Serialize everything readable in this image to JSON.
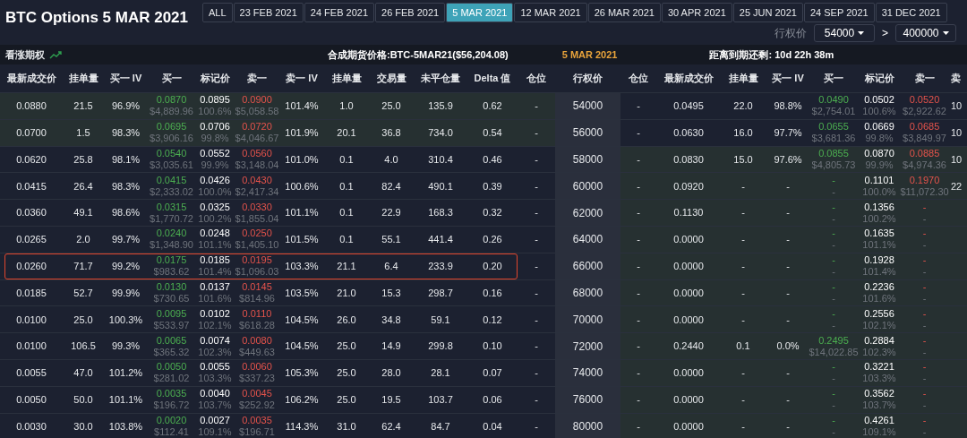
{
  "title": "BTC Options 5 MAR 2021",
  "expiry_tabs": [
    {
      "label": "ALL",
      "selected": false
    },
    {
      "label": "23 FEB 2021",
      "selected": false
    },
    {
      "label": "24 FEB 2021",
      "selected": false
    },
    {
      "label": "26 FEB 2021",
      "selected": false
    },
    {
      "label": "5 MAR 2021",
      "selected": true
    },
    {
      "label": "12 MAR 2021",
      "selected": false
    },
    {
      "label": "26 MAR 2021",
      "selected": false
    },
    {
      "label": "30 APR 2021",
      "selected": false
    },
    {
      "label": "25 JUN 2021",
      "selected": false
    },
    {
      "label": "24 SEP 2021",
      "selected": false
    },
    {
      "label": "31 DEC 2021",
      "selected": false
    }
  ],
  "strike_filter": {
    "label": "行权价",
    "min": "54000",
    "separator": ">",
    "max": "400000"
  },
  "info_bar": {
    "side_label": "看涨期权",
    "futures_price": "合成期货价格:BTC-5MAR21($56,204.08)",
    "expiry": "5 MAR 2021",
    "time_left": "距离到期还剩: 10d 22h 38m"
  },
  "call_columns": [
    {
      "label": "最新成交价"
    },
    {
      "label": "挂单量"
    },
    {
      "label": "买一 IV"
    },
    {
      "label": "买一",
      "kind": "bid"
    },
    {
      "label": "标记价",
      "kind": "mark"
    },
    {
      "label": "卖一",
      "kind": "ask"
    },
    {
      "label": "卖一 IV"
    },
    {
      "label": "挂单量"
    },
    {
      "label": "交易量"
    },
    {
      "label": "未平仓量"
    },
    {
      "label": "Delta 值"
    },
    {
      "label": "仓位"
    }
  ],
  "strike_column": "行权价",
  "put_columns": [
    {
      "label": "仓位"
    },
    {
      "label": "最新成交价"
    },
    {
      "label": "挂单量"
    },
    {
      "label": "买一 IV"
    },
    {
      "label": "买一",
      "kind": "bid"
    },
    {
      "label": "标记价",
      "kind": "mark"
    },
    {
      "label": "卖一",
      "kind": "ask"
    },
    {
      "label": "卖"
    }
  ],
  "rows": [
    {
      "strike": "54000",
      "call_itm": true,
      "put_itm": false,
      "highlighted": false,
      "call": [
        "0.0880",
        "21.5",
        "96.9%",
        {
          "price": "0.0870",
          "sub": "$4,889.96"
        },
        {
          "price": "0.0895",
          "sub": "100.6%"
        },
        {
          "price": "0.0900",
          "sub": "$5,058.58"
        },
        "101.4%",
        "1.0",
        "25.0",
        "135.9",
        "0.62",
        "-"
      ],
      "put": [
        "-",
        "0.0495",
        "22.0",
        "98.8%",
        {
          "price": "0.0490",
          "sub": "$2,754.01"
        },
        {
          "price": "0.0502",
          "sub": "100.6%"
        },
        {
          "price": "0.0520",
          "sub": "$2,922.62"
        },
        "10"
      ]
    },
    {
      "strike": "56000",
      "call_itm": true,
      "put_itm": false,
      "highlighted": false,
      "call": [
        "0.0700",
        "1.5",
        "98.3%",
        {
          "price": "0.0695",
          "sub": "$3,906.16"
        },
        {
          "price": "0.0706",
          "sub": "99.8%"
        },
        {
          "price": "0.0720",
          "sub": "$4,046.67"
        },
        "101.9%",
        "20.1",
        "36.8",
        "734.0",
        "0.54",
        "-"
      ],
      "put": [
        "-",
        "0.0630",
        "16.0",
        "97.7%",
        {
          "price": "0.0655",
          "sub": "$3,681.36"
        },
        {
          "price": "0.0669",
          "sub": "99.8%"
        },
        {
          "price": "0.0685",
          "sub": "$3,849.97"
        },
        "10"
      ]
    },
    {
      "strike": "58000",
      "call_itm": false,
      "put_itm": true,
      "highlighted": false,
      "call": [
        "0.0620",
        "25.8",
        "98.1%",
        {
          "price": "0.0540",
          "sub": "$3,035.61"
        },
        {
          "price": "0.0552",
          "sub": "99.9%"
        },
        {
          "price": "0.0560",
          "sub": "$3,148.04"
        },
        "101.0%",
        "0.1",
        "4.0",
        "310.4",
        "0.46",
        "-"
      ],
      "put": [
        "-",
        "0.0830",
        "15.0",
        "97.6%",
        {
          "price": "0.0855",
          "sub": "$4,805.73"
        },
        {
          "price": "0.0870",
          "sub": "99.9%"
        },
        {
          "price": "0.0885",
          "sub": "$4,974.36"
        },
        "10"
      ]
    },
    {
      "strike": "60000",
      "call_itm": false,
      "put_itm": true,
      "highlighted": false,
      "call": [
        "0.0415",
        "26.4",
        "98.3%",
        {
          "price": "0.0415",
          "sub": "$2,333.02"
        },
        {
          "price": "0.0426",
          "sub": "100.0%"
        },
        {
          "price": "0.0430",
          "sub": "$2,417.34"
        },
        "100.6%",
        "0.1",
        "82.4",
        "490.1",
        "0.39",
        "-"
      ],
      "put": [
        "-",
        "0.0920",
        "-",
        "-",
        {
          "price": "-",
          "sub": "-"
        },
        {
          "price": "0.1101",
          "sub": "100.0%"
        },
        {
          "price": "0.1970",
          "sub": "$11,072.30"
        },
        "22"
      ]
    },
    {
      "strike": "62000",
      "call_itm": false,
      "put_itm": true,
      "highlighted": false,
      "call": [
        "0.0360",
        "49.1",
        "98.6%",
        {
          "price": "0.0315",
          "sub": "$1,770.72"
        },
        {
          "price": "0.0325",
          "sub": "100.2%"
        },
        {
          "price": "0.0330",
          "sub": "$1,855.04"
        },
        "101.1%",
        "0.1",
        "22.9",
        "168.3",
        "0.32",
        "-"
      ],
      "put": [
        "-",
        "0.1130",
        "-",
        "-",
        {
          "price": "-",
          "sub": "-"
        },
        {
          "price": "0.1356",
          "sub": "100.2%"
        },
        {
          "price": "-",
          "sub": "-"
        }
      ]
    },
    {
      "strike": "64000",
      "call_itm": false,
      "put_itm": true,
      "highlighted": false,
      "call": [
        "0.0265",
        "2.0",
        "99.7%",
        {
          "price": "0.0240",
          "sub": "$1,348.90"
        },
        {
          "price": "0.0248",
          "sub": "101.1%"
        },
        {
          "price": "0.0250",
          "sub": "$1,405.10"
        },
        "101.5%",
        "0.1",
        "55.1",
        "441.4",
        "0.26",
        "-"
      ],
      "put": [
        "-",
        "0.0000",
        "-",
        "-",
        {
          "price": "-",
          "sub": "-"
        },
        {
          "price": "0.1635",
          "sub": "101.1%"
        },
        {
          "price": "-",
          "sub": "-"
        }
      ]
    },
    {
      "strike": "66000",
      "call_itm": false,
      "put_itm": true,
      "highlighted": true,
      "call": [
        "0.0260",
        "71.7",
        "99.2%",
        {
          "price": "0.0175",
          "sub": "$983.62"
        },
        {
          "price": "0.0185",
          "sub": "101.4%"
        },
        {
          "price": "0.0195",
          "sub": "$1,096.03"
        },
        "103.3%",
        "21.1",
        "6.4",
        "233.9",
        "0.20",
        "-"
      ],
      "put": [
        "-",
        "0.0000",
        "-",
        "-",
        {
          "price": "-",
          "sub": "-"
        },
        {
          "price": "0.1928",
          "sub": "101.4%"
        },
        {
          "price": "-",
          "sub": "-"
        }
      ]
    },
    {
      "strike": "68000",
      "call_itm": false,
      "put_itm": true,
      "highlighted": false,
      "call": [
        "0.0185",
        "52.7",
        "99.9%",
        {
          "price": "0.0130",
          "sub": "$730.65"
        },
        {
          "price": "0.0137",
          "sub": "101.6%"
        },
        {
          "price": "0.0145",
          "sub": "$814.96"
        },
        "103.5%",
        "21.0",
        "15.3",
        "298.7",
        "0.16",
        "-"
      ],
      "put": [
        "-",
        "0.0000",
        "-",
        "-",
        {
          "price": "-",
          "sub": "-"
        },
        {
          "price": "0.2236",
          "sub": "101.6%"
        },
        {
          "price": "-",
          "sub": "-"
        }
      ]
    },
    {
      "strike": "70000",
      "call_itm": false,
      "put_itm": true,
      "highlighted": false,
      "call": [
        "0.0100",
        "25.0",
        "100.3%",
        {
          "price": "0.0095",
          "sub": "$533.97"
        },
        {
          "price": "0.0102",
          "sub": "102.1%"
        },
        {
          "price": "0.0110",
          "sub": "$618.28"
        },
        "104.5%",
        "26.0",
        "34.8",
        "59.1",
        "0.12",
        "-"
      ],
      "put": [
        "-",
        "0.0000",
        "-",
        "-",
        {
          "price": "-",
          "sub": "-"
        },
        {
          "price": "0.2556",
          "sub": "102.1%"
        },
        {
          "price": "-",
          "sub": "-"
        }
      ]
    },
    {
      "strike": "72000",
      "call_itm": false,
      "put_itm": true,
      "highlighted": false,
      "call": [
        "0.0100",
        "106.5",
        "99.3%",
        {
          "price": "0.0065",
          "sub": "$365.32"
        },
        {
          "price": "0.0074",
          "sub": "102.3%"
        },
        {
          "price": "0.0080",
          "sub": "$449.63"
        },
        "104.5%",
        "25.0",
        "14.9",
        "299.8",
        "0.10",
        "-"
      ],
      "put": [
        "-",
        "0.2440",
        "0.1",
        "0.0%",
        {
          "price": "0.2495",
          "sub": "$14,022.85"
        },
        {
          "price": "0.2884",
          "sub": "102.3%"
        },
        {
          "price": "-",
          "sub": "-"
        }
      ]
    },
    {
      "strike": "74000",
      "call_itm": false,
      "put_itm": true,
      "highlighted": false,
      "call": [
        "0.0055",
        "47.0",
        "101.2%",
        {
          "price": "0.0050",
          "sub": "$281.02"
        },
        {
          "price": "0.0055",
          "sub": "103.3%"
        },
        {
          "price": "0.0060",
          "sub": "$337.23"
        },
        "105.3%",
        "25.0",
        "28.0",
        "28.1",
        "0.07",
        "-"
      ],
      "put": [
        "-",
        "0.0000",
        "-",
        "-",
        {
          "price": "-",
          "sub": "-"
        },
        {
          "price": "0.3221",
          "sub": "103.3%"
        },
        {
          "price": "-",
          "sub": "-"
        }
      ]
    },
    {
      "strike": "76000",
      "call_itm": false,
      "put_itm": true,
      "highlighted": false,
      "call": [
        "0.0050",
        "50.0",
        "101.1%",
        {
          "price": "0.0035",
          "sub": "$196.72"
        },
        {
          "price": "0.0040",
          "sub": "103.7%"
        },
        {
          "price": "0.0045",
          "sub": "$252.92"
        },
        "106.2%",
        "25.0",
        "19.5",
        "103.7",
        "0.06",
        "-"
      ],
      "put": [
        "-",
        "0.0000",
        "-",
        "-",
        {
          "price": "-",
          "sub": "-"
        },
        {
          "price": "0.3562",
          "sub": "103.7%"
        },
        {
          "price": "-",
          "sub": "-"
        }
      ]
    },
    {
      "strike": "80000",
      "call_itm": false,
      "put_itm": true,
      "highlighted": false,
      "call": [
        "0.0030",
        "30.0",
        "103.8%",
        {
          "price": "0.0020",
          "sub": "$112.41"
        },
        {
          "price": "0.0027",
          "sub": "109.1%"
        },
        {
          "price": "0.0035",
          "sub": "$196.71"
        },
        "114.3%",
        "31.0",
        "62.4",
        "84.7",
        "0.04",
        "-"
      ],
      "put": [
        "-",
        "0.0000",
        "-",
        "-",
        {
          "price": "-",
          "sub": "-"
        },
        {
          "price": "0.4261",
          "sub": "109.1%"
        },
        {
          "price": "-",
          "sub": "-"
        }
      ]
    }
  ]
}
